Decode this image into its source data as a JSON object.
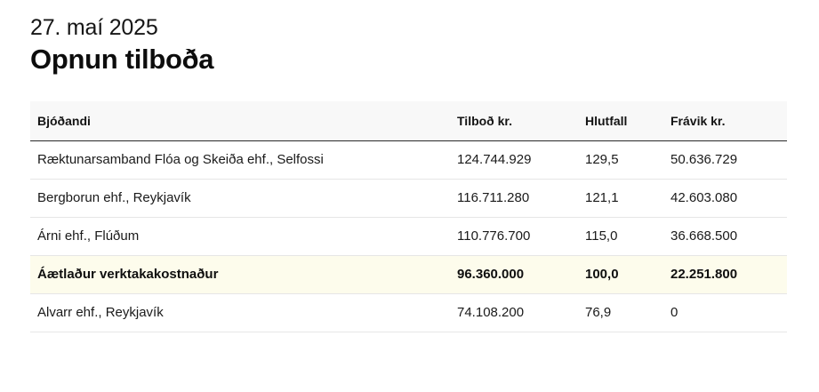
{
  "header": {
    "date": "27. maí 2025",
    "title": "Opnun tilboða"
  },
  "table": {
    "columns": [
      "Bjóðandi",
      "Tilboð kr.",
      "Hlutfall",
      "Frávik kr."
    ],
    "rows": [
      {
        "bidder": "Ræktunarsamband Flóa og Skeiða ehf., Selfossi",
        "bid": "124.744.929",
        "ratio": "129,5",
        "deviation": "50.636.729",
        "highlight": false
      },
      {
        "bidder": "Bergborun ehf., Reykjavík",
        "bid": "116.711.280",
        "ratio": "121,1",
        "deviation": "42.603.080",
        "highlight": false
      },
      {
        "bidder": "Árni ehf., Flúðum",
        "bid": "110.776.700",
        "ratio": "115,0",
        "deviation": "36.668.500",
        "highlight": false
      },
      {
        "bidder": "Áætlaður verktakakostnaður",
        "bid": "96.360.000",
        "ratio": "100,0",
        "deviation": "22.251.800",
        "highlight": true
      },
      {
        "bidder": "Alvarr ehf., Reykjavík",
        "bid": "74.108.200",
        "ratio": "76,9",
        "deviation": "0",
        "highlight": false
      }
    ]
  },
  "colors": {
    "highlight_row": "#fdfcec",
    "header_row": "#f8f8f8",
    "text": "#111111"
  }
}
